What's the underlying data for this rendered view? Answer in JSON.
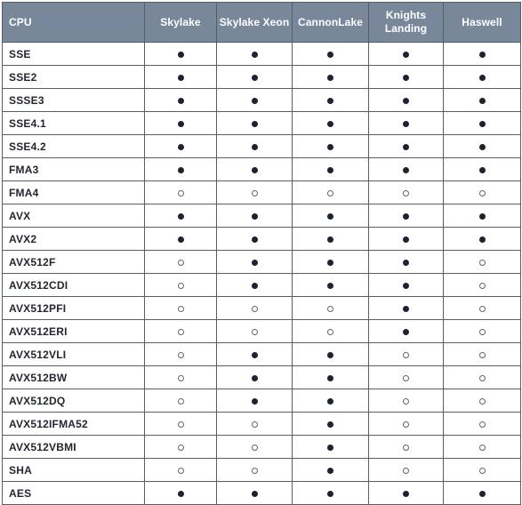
{
  "table": {
    "columns": [
      {
        "key": "feature",
        "label": "CPU",
        "align": "left"
      },
      {
        "key": "skylake",
        "label": "Skylake",
        "align": "center"
      },
      {
        "key": "skylake_xeon",
        "label": "Skylake Xeon",
        "align": "center"
      },
      {
        "key": "cannonlake",
        "label": "CannonLake",
        "align": "center"
      },
      {
        "key": "knights_landing",
        "label": "Knights\nLanding",
        "align": "center"
      },
      {
        "key": "haswell",
        "label": "Haswell",
        "align": "center"
      }
    ],
    "header_labels": {
      "feature": "CPU",
      "skylake": "Skylake",
      "skylake_xeon": "Skylake Xeon",
      "cannonlake": "CannonLake",
      "knights_landing_line1": "Knights",
      "knights_landing_line2": "Landing",
      "haswell": "Haswell"
    },
    "marks": {
      "supported": "●",
      "unsupported": "○",
      "supported_name": "filled-dot-icon",
      "unsupported_name": "hollow-dot-icon"
    },
    "rows": [
      {
        "feature": "SSE",
        "values": [
          true,
          true,
          true,
          true,
          true
        ]
      },
      {
        "feature": "SSE2",
        "values": [
          true,
          true,
          true,
          true,
          true
        ]
      },
      {
        "feature": "SSSE3",
        "values": [
          true,
          true,
          true,
          true,
          true
        ]
      },
      {
        "feature": "SSE4.1",
        "values": [
          true,
          true,
          true,
          true,
          true
        ]
      },
      {
        "feature": "SSE4.2",
        "values": [
          true,
          true,
          true,
          true,
          true
        ]
      },
      {
        "feature": "FMA3",
        "values": [
          true,
          true,
          true,
          true,
          true
        ]
      },
      {
        "feature": "FMA4",
        "values": [
          false,
          false,
          false,
          false,
          false
        ]
      },
      {
        "feature": "AVX",
        "values": [
          true,
          true,
          true,
          true,
          true
        ]
      },
      {
        "feature": "AVX2",
        "values": [
          true,
          true,
          true,
          true,
          true
        ]
      },
      {
        "feature": "AVX512F",
        "values": [
          false,
          true,
          true,
          true,
          false
        ]
      },
      {
        "feature": "AVX512CDI",
        "values": [
          false,
          true,
          true,
          true,
          false
        ]
      },
      {
        "feature": "AVX512PFI",
        "values": [
          false,
          false,
          false,
          true,
          false
        ]
      },
      {
        "feature": "AVX512ERI",
        "values": [
          false,
          false,
          false,
          true,
          false
        ]
      },
      {
        "feature": "AVX512VLI",
        "values": [
          false,
          true,
          true,
          false,
          false
        ]
      },
      {
        "feature": "AVX512BW",
        "values": [
          false,
          true,
          true,
          false,
          false
        ]
      },
      {
        "feature": "AVX512DQ",
        "values": [
          false,
          true,
          true,
          false,
          false
        ]
      },
      {
        "feature": "AVX512IFMA52",
        "values": [
          false,
          false,
          true,
          false,
          false
        ]
      },
      {
        "feature": "AVX512VBMI",
        "values": [
          false,
          false,
          true,
          false,
          false
        ]
      },
      {
        "feature": "SHA",
        "values": [
          false,
          false,
          true,
          false,
          false
        ]
      },
      {
        "feature": "AES",
        "values": [
          true,
          true,
          true,
          true,
          true
        ]
      }
    ]
  },
  "colors": {
    "header_background": "#78889a",
    "header_text": "#ffffff",
    "border": "#565f67",
    "cell_background": "#ffffff",
    "cell_text": "#232730",
    "mark_filled": "#1d2230",
    "mark_hollow_border": "#5b6472"
  }
}
